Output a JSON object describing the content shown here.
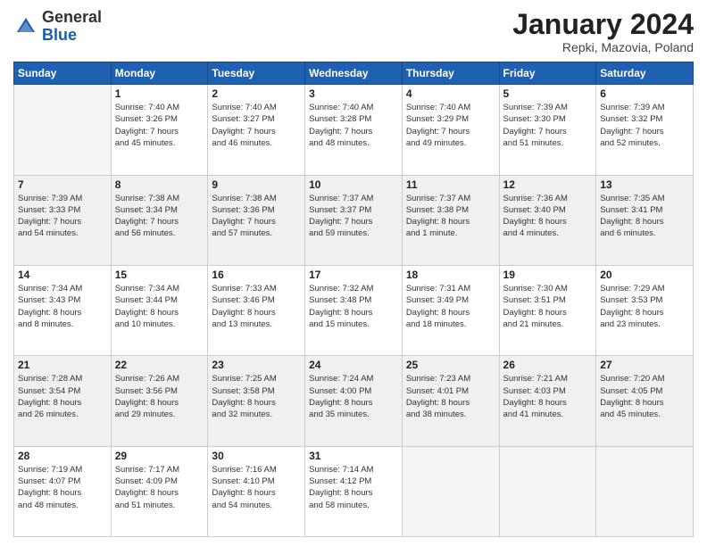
{
  "header": {
    "logo_general": "General",
    "logo_blue": "Blue",
    "month_title": "January 2024",
    "subtitle": "Repki, Mazovia, Poland"
  },
  "days_of_week": [
    "Sunday",
    "Monday",
    "Tuesday",
    "Wednesday",
    "Thursday",
    "Friday",
    "Saturday"
  ],
  "weeks": [
    {
      "shaded": false,
      "days": [
        {
          "number": "",
          "info": ""
        },
        {
          "number": "1",
          "info": "Sunrise: 7:40 AM\nSunset: 3:26 PM\nDaylight: 7 hours\nand 45 minutes."
        },
        {
          "number": "2",
          "info": "Sunrise: 7:40 AM\nSunset: 3:27 PM\nDaylight: 7 hours\nand 46 minutes."
        },
        {
          "number": "3",
          "info": "Sunrise: 7:40 AM\nSunset: 3:28 PM\nDaylight: 7 hours\nand 48 minutes."
        },
        {
          "number": "4",
          "info": "Sunrise: 7:40 AM\nSunset: 3:29 PM\nDaylight: 7 hours\nand 49 minutes."
        },
        {
          "number": "5",
          "info": "Sunrise: 7:39 AM\nSunset: 3:30 PM\nDaylight: 7 hours\nand 51 minutes."
        },
        {
          "number": "6",
          "info": "Sunrise: 7:39 AM\nSunset: 3:32 PM\nDaylight: 7 hours\nand 52 minutes."
        }
      ]
    },
    {
      "shaded": true,
      "days": [
        {
          "number": "7",
          "info": "Sunrise: 7:39 AM\nSunset: 3:33 PM\nDaylight: 7 hours\nand 54 minutes."
        },
        {
          "number": "8",
          "info": "Sunrise: 7:38 AM\nSunset: 3:34 PM\nDaylight: 7 hours\nand 56 minutes."
        },
        {
          "number": "9",
          "info": "Sunrise: 7:38 AM\nSunset: 3:36 PM\nDaylight: 7 hours\nand 57 minutes."
        },
        {
          "number": "10",
          "info": "Sunrise: 7:37 AM\nSunset: 3:37 PM\nDaylight: 7 hours\nand 59 minutes."
        },
        {
          "number": "11",
          "info": "Sunrise: 7:37 AM\nSunset: 3:38 PM\nDaylight: 8 hours\nand 1 minute."
        },
        {
          "number": "12",
          "info": "Sunrise: 7:36 AM\nSunset: 3:40 PM\nDaylight: 8 hours\nand 4 minutes."
        },
        {
          "number": "13",
          "info": "Sunrise: 7:35 AM\nSunset: 3:41 PM\nDaylight: 8 hours\nand 6 minutes."
        }
      ]
    },
    {
      "shaded": false,
      "days": [
        {
          "number": "14",
          "info": "Sunrise: 7:34 AM\nSunset: 3:43 PM\nDaylight: 8 hours\nand 8 minutes."
        },
        {
          "number": "15",
          "info": "Sunrise: 7:34 AM\nSunset: 3:44 PM\nDaylight: 8 hours\nand 10 minutes."
        },
        {
          "number": "16",
          "info": "Sunrise: 7:33 AM\nSunset: 3:46 PM\nDaylight: 8 hours\nand 13 minutes."
        },
        {
          "number": "17",
          "info": "Sunrise: 7:32 AM\nSunset: 3:48 PM\nDaylight: 8 hours\nand 15 minutes."
        },
        {
          "number": "18",
          "info": "Sunrise: 7:31 AM\nSunset: 3:49 PM\nDaylight: 8 hours\nand 18 minutes."
        },
        {
          "number": "19",
          "info": "Sunrise: 7:30 AM\nSunset: 3:51 PM\nDaylight: 8 hours\nand 21 minutes."
        },
        {
          "number": "20",
          "info": "Sunrise: 7:29 AM\nSunset: 3:53 PM\nDaylight: 8 hours\nand 23 minutes."
        }
      ]
    },
    {
      "shaded": true,
      "days": [
        {
          "number": "21",
          "info": "Sunrise: 7:28 AM\nSunset: 3:54 PM\nDaylight: 8 hours\nand 26 minutes."
        },
        {
          "number": "22",
          "info": "Sunrise: 7:26 AM\nSunset: 3:56 PM\nDaylight: 8 hours\nand 29 minutes."
        },
        {
          "number": "23",
          "info": "Sunrise: 7:25 AM\nSunset: 3:58 PM\nDaylight: 8 hours\nand 32 minutes."
        },
        {
          "number": "24",
          "info": "Sunrise: 7:24 AM\nSunset: 4:00 PM\nDaylight: 8 hours\nand 35 minutes."
        },
        {
          "number": "25",
          "info": "Sunrise: 7:23 AM\nSunset: 4:01 PM\nDaylight: 8 hours\nand 38 minutes."
        },
        {
          "number": "26",
          "info": "Sunrise: 7:21 AM\nSunset: 4:03 PM\nDaylight: 8 hours\nand 41 minutes."
        },
        {
          "number": "27",
          "info": "Sunrise: 7:20 AM\nSunset: 4:05 PM\nDaylight: 8 hours\nand 45 minutes."
        }
      ]
    },
    {
      "shaded": false,
      "days": [
        {
          "number": "28",
          "info": "Sunrise: 7:19 AM\nSunset: 4:07 PM\nDaylight: 8 hours\nand 48 minutes."
        },
        {
          "number": "29",
          "info": "Sunrise: 7:17 AM\nSunset: 4:09 PM\nDaylight: 8 hours\nand 51 minutes."
        },
        {
          "number": "30",
          "info": "Sunrise: 7:16 AM\nSunset: 4:10 PM\nDaylight: 8 hours\nand 54 minutes."
        },
        {
          "number": "31",
          "info": "Sunrise: 7:14 AM\nSunset: 4:12 PM\nDaylight: 8 hours\nand 58 minutes."
        },
        {
          "number": "",
          "info": ""
        },
        {
          "number": "",
          "info": ""
        },
        {
          "number": "",
          "info": ""
        }
      ]
    }
  ]
}
